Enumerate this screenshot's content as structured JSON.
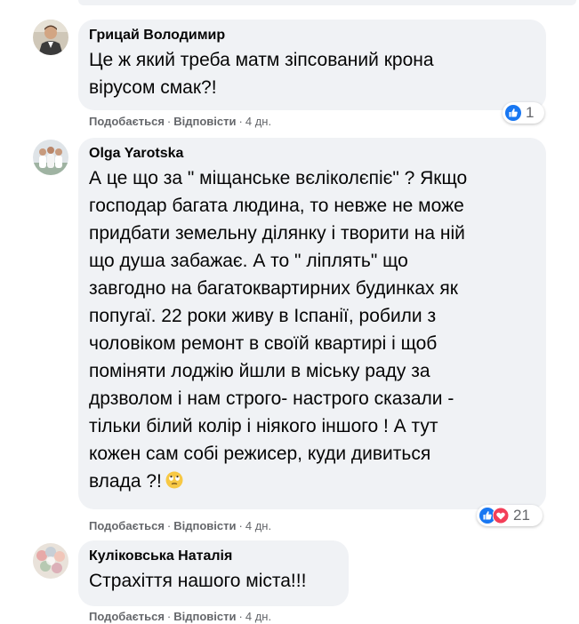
{
  "comments": [
    {
      "author": "Грицай Володимир",
      "lines": [
        "Це ж який треба матм зіпсований крона",
        "вірусом смак?!"
      ],
      "like_label": "Подобається",
      "reply_label": "Відповісти",
      "time": "4 дн.",
      "reaction_count": "1",
      "reaction_icons": [
        "like-icon"
      ]
    },
    {
      "author": "Olga Yarotska",
      "lines": [
        "А це що за \" міщанське вєліколєпіє\" ? Якщо",
        "господар багата людина, то невже не може",
        "придбати земельну ділянку і творити на ній",
        "що душа забажає. А то \" ліплять\" що",
        "завгодно на багатоквартирних будинках як",
        "попугаї. 22 роки живу в Іспанії, робили з",
        "чоловіком ремонт в своїй квартирі і щоб",
        "поміняти лоджію йшли в міську раду за",
        "дрзволом і нам строго- настрого сказали -",
        "тільки білий колір і ніякого іншого ! А тут",
        "кожен сам собі режисер, куди дивиться",
        "влада ?!"
      ],
      "inline_emoji": "rolling-eyes-emoji",
      "like_label": "Подобається",
      "reply_label": "Відповісти",
      "time": "4 дн.",
      "reaction_count": "21",
      "reaction_icons": [
        "like-icon",
        "love-icon"
      ]
    },
    {
      "author": "Куліковська Наталія",
      "lines": [
        "Страхіття нашого міста!!!"
      ],
      "like_label": "Подобається",
      "reply_label": "Відповісти",
      "time": "4 дн."
    }
  ],
  "separator": "·",
  "colors": {
    "bubble": "#f0f2f5",
    "meta_text": "#65676b",
    "like_blue": "#1877f2",
    "love_red": "#f33e58"
  }
}
